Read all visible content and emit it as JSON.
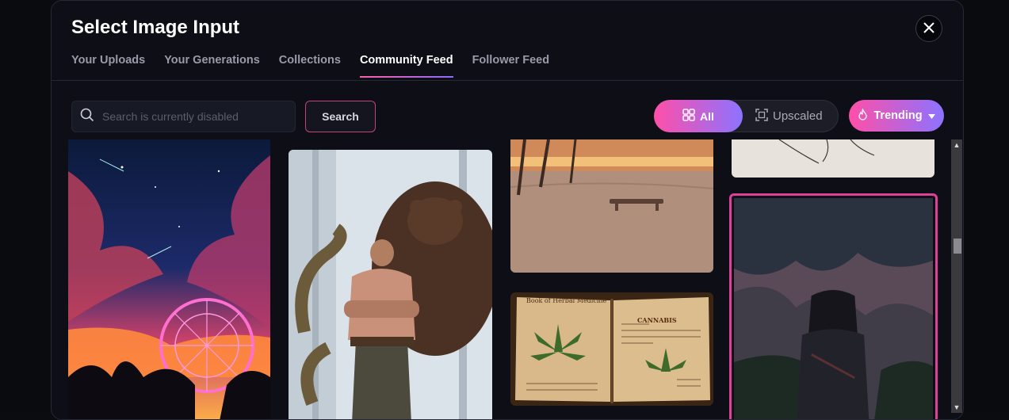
{
  "modal": {
    "title": "Select Image Input",
    "close_label": "✕"
  },
  "tabs": [
    {
      "label": "Your Uploads",
      "active": false
    },
    {
      "label": "Your Generations",
      "active": false
    },
    {
      "label": "Collections",
      "active": false
    },
    {
      "label": "Community Feed",
      "active": true
    },
    {
      "label": "Follower Feed",
      "active": false
    }
  ],
  "search": {
    "placeholder": "Search is currently disabled",
    "button_label": "Search"
  },
  "filters": {
    "all_label": "All",
    "upscaled_label": "Upscaled",
    "selected": "All"
  },
  "sort": {
    "label": "Trending"
  },
  "gallery": {
    "items": [
      {
        "subject": "ferris-wheel-night-sky"
      },
      {
        "subject": "bodybuilder-with-bear-and-snake"
      },
      {
        "subject": "beach-sunset-bench"
      },
      {
        "subject": "herbal-medicine-book",
        "page_text_left": "Book of Herbal Medicine",
        "page_text_right": "CANNABIS"
      },
      {
        "subject": "sketch-on-paper"
      },
      {
        "subject": "dark-armored-warrior",
        "selected": true
      }
    ]
  },
  "colors": {
    "accent_start": "#ff4fa8",
    "accent_end": "#8c73ff",
    "background": "#0d0e16",
    "selected_border": "#e0409a"
  }
}
